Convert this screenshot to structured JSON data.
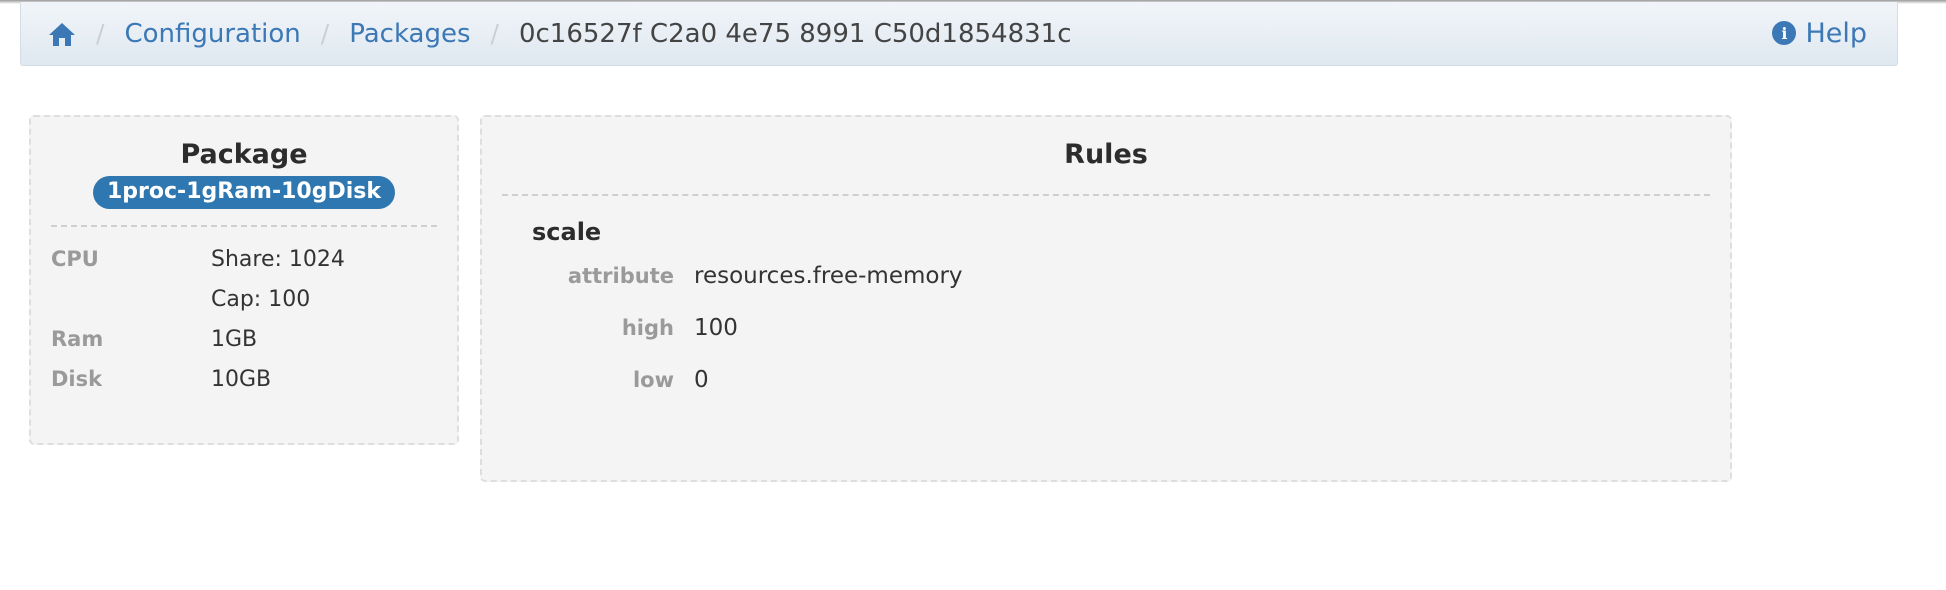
{
  "breadcrumb": {
    "home_icon": "home-icon",
    "items": [
      "Configuration",
      "Packages"
    ],
    "current": "0c16527f C2a0 4e75 8991 C50d1854831c",
    "separator": "/"
  },
  "help": {
    "icon": "info-circle-icon",
    "icon_glyph": "i",
    "label": "Help"
  },
  "package": {
    "title": "Package",
    "name": "1proc-1gRam-10gDisk",
    "specs": [
      {
        "label": "CPU",
        "value": "Share: 1024"
      },
      {
        "label": "",
        "value": "Cap: 100"
      },
      {
        "label": "Ram",
        "value": "1GB"
      },
      {
        "label": "Disk",
        "value": "10GB"
      }
    ]
  },
  "rules": {
    "title": "Rules",
    "items": [
      {
        "name": "scale",
        "props": [
          {
            "label": "attribute",
            "value": "resources.free-memory"
          },
          {
            "label": "high",
            "value": "100"
          },
          {
            "label": "low",
            "value": "0"
          }
        ]
      }
    ]
  },
  "colors": {
    "link": "#3b78b5",
    "badge": "#2f77b0",
    "well_bg": "#f4f4f4",
    "label_gray": "#9a9a9a"
  }
}
